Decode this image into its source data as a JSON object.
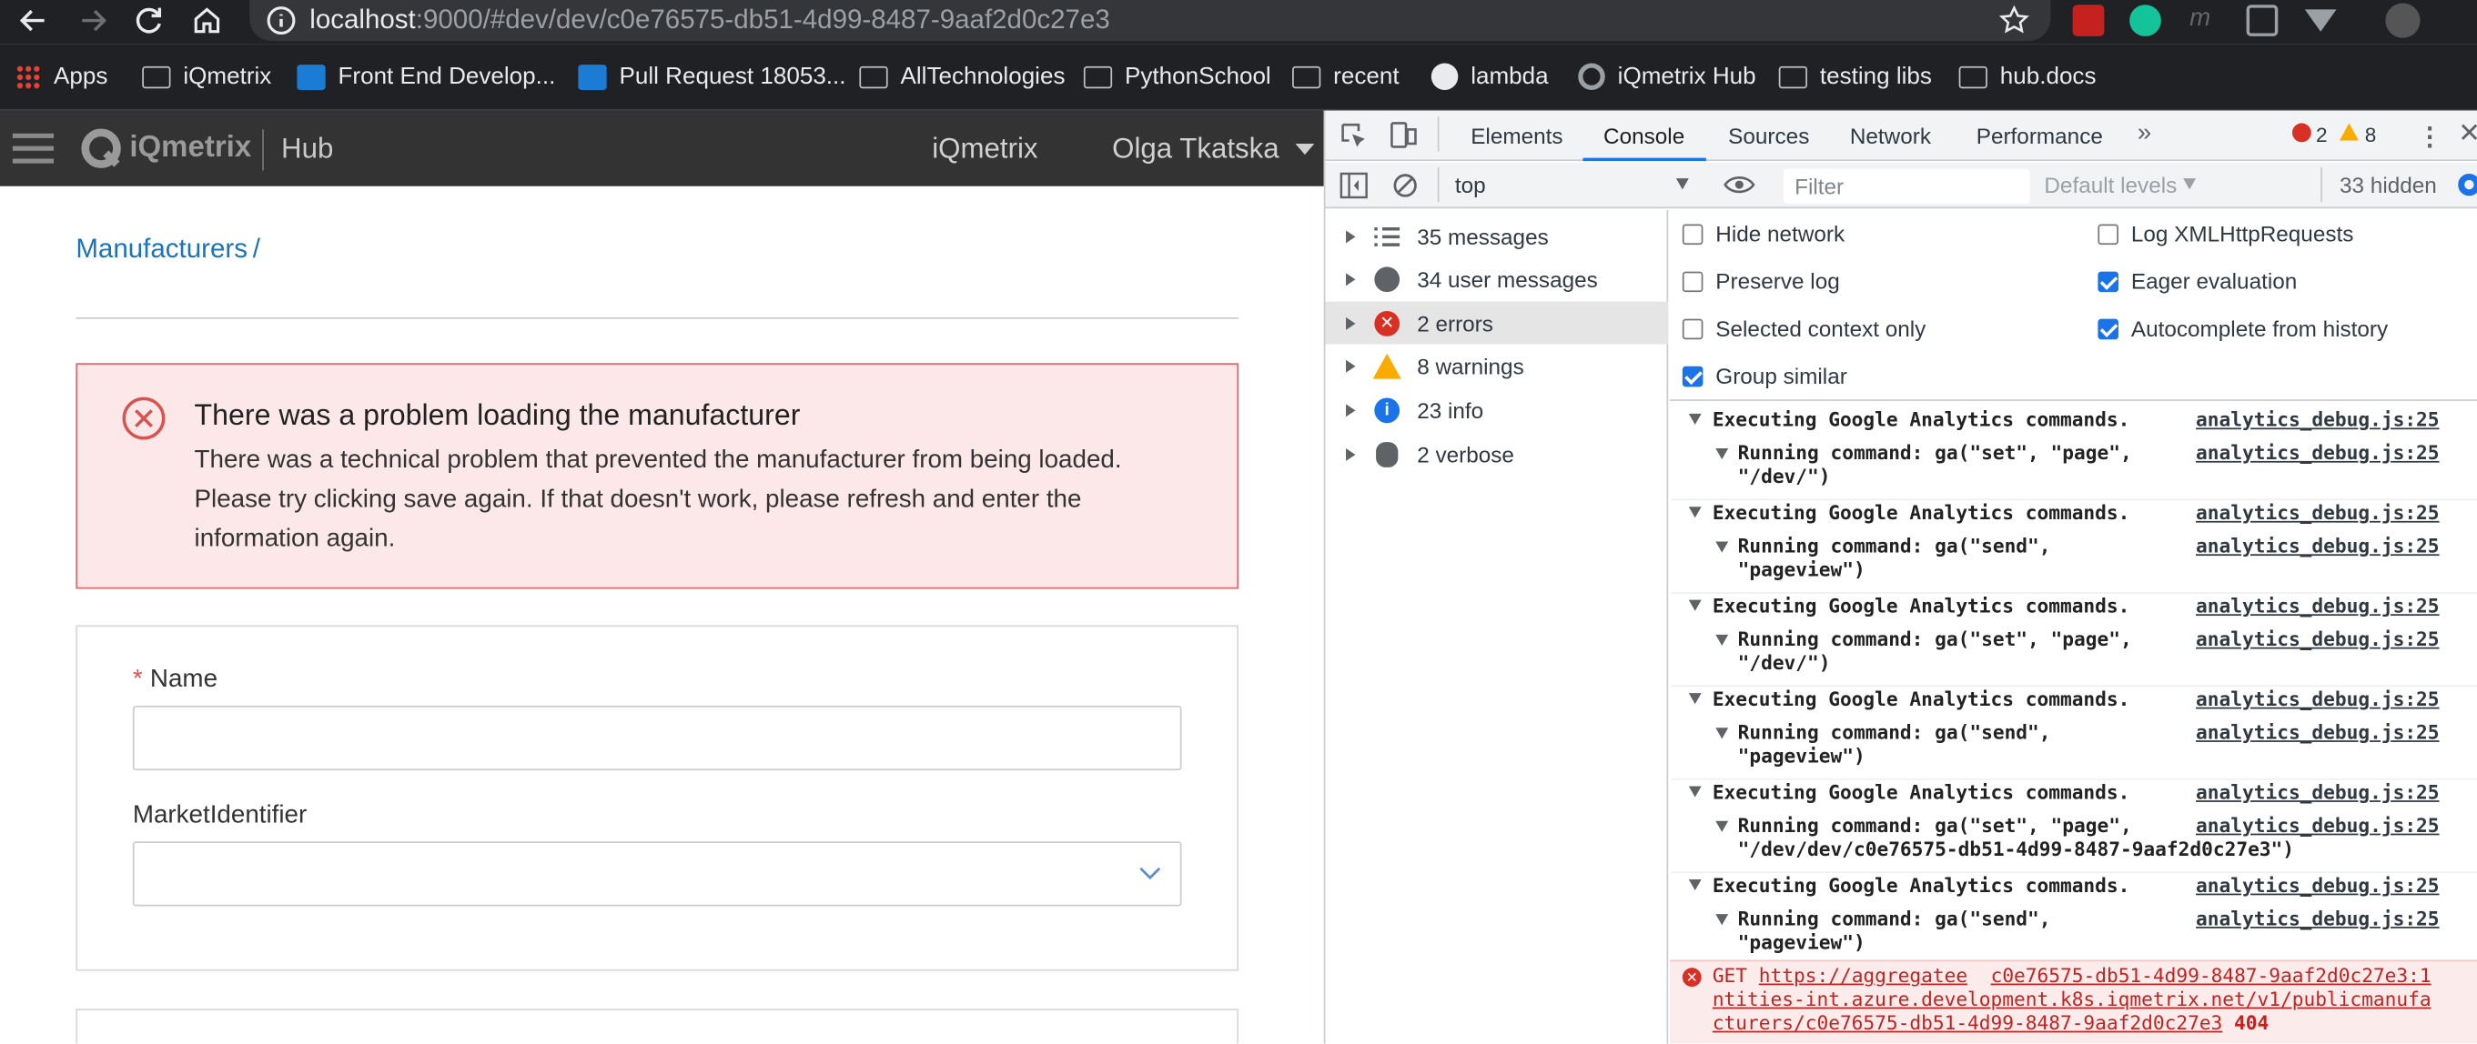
{
  "browser": {
    "url_host": "localhost",
    "url_rest": ":9000/#dev/dev/c0e76575-db51-4d99-8487-9aaf2d0c27e3",
    "bookmarks": [
      "Apps",
      "iQmetrix",
      "Front End Develop...",
      "Pull Request 18053...",
      "AllTechnologies",
      "PythonSchool",
      "recent",
      "lambda",
      "iQmetrix Hub",
      "testing libs",
      "hub.docs"
    ]
  },
  "app": {
    "logo": "iQmetrix",
    "product": "Hub",
    "nav_company": "iQmetrix",
    "user_name": "Olga Tkatska",
    "breadcrumb": "Manufacturers",
    "breadcrumb_sep": "/",
    "error_title": "There was a problem loading the manufacturer",
    "error_line1": "There was a technical problem that prevented the manufacturer from being loaded.",
    "error_line2": "Please try clicking save again. If that doesn't work, please refresh and enter the",
    "error_line3": "information again.",
    "required_mark": "*",
    "name_label": "Name",
    "market_label": "MarketIdentifier"
  },
  "devtools": {
    "tabs": [
      "Elements",
      "Console",
      "Sources",
      "Network",
      "Performance"
    ],
    "error_count": "2",
    "warning_count": "8",
    "context": "top",
    "filter_placeholder": "Filter",
    "levels": "Default levels",
    "hidden": "33 hidden",
    "sidebar": [
      "35 messages",
      "34 user messages",
      "2 errors",
      "8 warnings",
      "23 info",
      "2 verbose"
    ],
    "settings": {
      "hide_network": "Hide network",
      "preserve_log": "Preserve log",
      "selected_context": "Selected context only",
      "group_similar": "Group similar",
      "log_xhr": "Log XMLHttpRequests",
      "eager_eval": "Eager evaluation",
      "autocomplete": "Autocomplete from history"
    },
    "log_source": "analytics_debug.js:25",
    "logs": [
      {
        "head": "Executing Google Analytics commands.",
        "cmd1": "Running command: ga(\"set\", \"page\",",
        "cmd2": "\"/dev/\")"
      },
      {
        "head": "Executing Google Analytics commands.",
        "cmd1": "Running command: ga(\"send\",",
        "cmd2": "\"pageview\")"
      },
      {
        "head": "Executing Google Analytics commands.",
        "cmd1": "Running command: ga(\"set\", \"page\",",
        "cmd2": "\"/dev/\")"
      },
      {
        "head": "Executing Google Analytics commands.",
        "cmd1": "Running command: ga(\"send\",",
        "cmd2": "\"pageview\")"
      },
      {
        "head": "Executing Google Analytics commands.",
        "cmd1": "Running command: ga(\"set\", \"page\",",
        "cmd2": "\"/dev/dev/c0e76575-db51-4d99-8487-9aaf2d0c27e3\")"
      },
      {
        "head": "Executing Google Analytics commands.",
        "cmd1": "Running command: ga(\"send\",",
        "cmd2": "\"pageview\")"
      }
    ],
    "error": {
      "method": "GET",
      "url1": "https://aggregatee",
      "url2": "ntities-int.azure.development.k8s.iqmetrix.net/v1/publicmanufa",
      "url3": "cturers/c0e76575-db51-4d99-8487-9aaf2d0c27e3",
      "source": "c0e76575-db51-4d99-8487-9aaf2d0c27e3:1",
      "status": "404"
    }
  },
  "colors": {
    "error_bg": "#fce8e8",
    "error_border": "#e26b6b",
    "link": "#1a73be",
    "accent": "#1a73e8"
  }
}
